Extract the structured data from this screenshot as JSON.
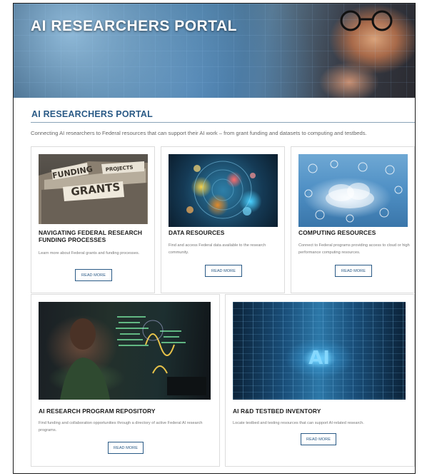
{
  "hero": {
    "title": "AI RESEARCHERS PORTAL"
  },
  "section": {
    "heading": "AI RESEARCHERS PORTAL",
    "intro": "Connecting AI researchers to Federal resources that can support their AI work – from grant funding and datasets to computing and testbeds."
  },
  "cards": [
    {
      "title": "NAVIGATING FEDERAL RESEARCH FUNDING PROCESSES",
      "description": "Learn more about Federal grants and funding processes.",
      "button": "READ MORE",
      "image_text": [
        "FUNDING",
        "PROJECTS",
        "GRANTS"
      ]
    },
    {
      "title": "DATA RESOURCES",
      "description": "Find and access Federal data available to the research community.",
      "button": "READ MORE"
    },
    {
      "title": "COMPUTING RESOURCES",
      "description": "Connect to Federal programs providing access to cloud or high performance computing resources.",
      "button": "READ MORE"
    },
    {
      "title": "AI RESEARCH PROGRAM REPOSITORY",
      "description": "Find funding and collaboration opportunities through a directory of active Federal AI research programs.",
      "button": "READ MORE"
    },
    {
      "title": "AI R&D TESTBED INVENTORY",
      "description": "Locate testbed and testing resources that can support AI-related research.",
      "button": "READ MORE",
      "image_text": "AI"
    }
  ],
  "colors": {
    "heading_blue": "#2a5a86",
    "border": "#dcdcdc"
  }
}
